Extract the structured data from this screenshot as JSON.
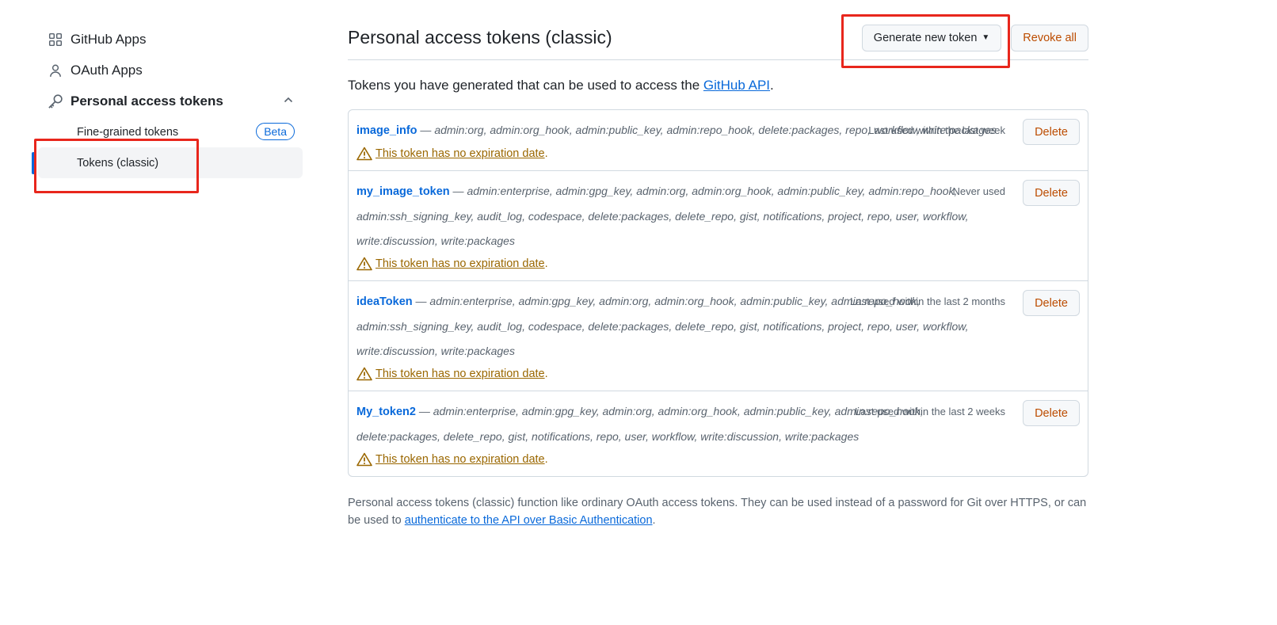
{
  "sidebar": {
    "github_apps": "GitHub Apps",
    "oauth_apps": "OAuth Apps",
    "pat": "Personal access tokens",
    "fine_grained": "Fine-grained tokens",
    "beta": "Beta",
    "classic": "Tokens (classic)"
  },
  "header": {
    "title": "Personal access tokens (classic)",
    "generate": "Generate new token",
    "revoke": "Revoke all"
  },
  "intro": {
    "text": "Tokens you have generated that can be used to access the ",
    "link": "GitHub API",
    "end": "."
  },
  "tokens": [
    {
      "name": "image_info",
      "scopes": " — admin:org, admin:org_hook, admin:public_key, admin:repo_hook, delete:packages, repo, workflow, write:packages",
      "used": "Last used within the last week",
      "warn": "This token has no expiration date",
      "delete": "Delete"
    },
    {
      "name": "my_image_token",
      "scopes": " — admin:enterprise, admin:gpg_key, admin:org, admin:org_hook, admin:public_key, admin:repo_hook, admin:ssh_signing_key, audit_log, codespace, delete:packages, delete_repo, gist, notifications, project, repo, user, workflow, write:discussion, write:packages",
      "used": "Never used",
      "warn": "This token has no expiration date",
      "delete": "Delete"
    },
    {
      "name": "ideaToken",
      "scopes": " — admin:enterprise, admin:gpg_key, admin:org, admin:org_hook, admin:public_key, admin:repo_hook, admin:ssh_signing_key, audit_log, codespace, delete:packages, delete_repo, gist, notifications, project, repo, user, workflow, write:discussion, write:packages",
      "used": "Last used within the last 2 months",
      "warn": "This token has no expiration date",
      "delete": "Delete"
    },
    {
      "name": "My_token2",
      "scopes": " — admin:enterprise, admin:gpg_key, admin:org, admin:org_hook, admin:public_key, admin:repo_hook, delete:packages, delete_repo, gist, notifications, repo, user, workflow, write:discussion, write:packages",
      "used": "Last used within the last 2 weeks",
      "warn": "This token has no expiration date",
      "delete": "Delete"
    }
  ],
  "footer": {
    "text": "Personal access tokens (classic) function like ordinary OAuth access tokens. They can be used instead of a password for Git over HTTPS, or can be used to ",
    "link": "authenticate to the API over Basic Authentication",
    "end": "."
  },
  "colors": {
    "accent": "#0969da",
    "danger": "#bc4c00",
    "warning": "#9a6700",
    "highlight": "#e8261c"
  }
}
